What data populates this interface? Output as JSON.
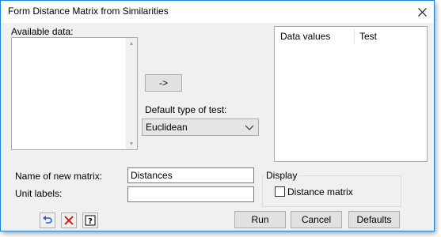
{
  "window": {
    "title": "Form Distance Matrix from Similarities"
  },
  "available_data": {
    "label": "Available data:"
  },
  "transfer_button": {
    "label": "->"
  },
  "default_test": {
    "label": "Default type of test:",
    "selected": "Euclidean"
  },
  "data_table": {
    "columns": [
      "Data values",
      "Test"
    ]
  },
  "new_matrix": {
    "label": "Name of new matrix:",
    "value": "Distances"
  },
  "unit_labels": {
    "label": "Unit labels:",
    "value": ""
  },
  "display": {
    "group_label": "Display",
    "distance_matrix_label": "Distance matrix",
    "distance_matrix_checked": false
  },
  "buttons": {
    "run": "Run",
    "cancel": "Cancel",
    "defaults": "Defaults"
  },
  "icons": {
    "restore": "undo-icon",
    "clear": "clear-x-icon",
    "help": "help-icon"
  },
  "colors": {
    "accent": "#1883d7",
    "clear_red": "#c42b1c",
    "restore_blue": "#2a5bd7"
  }
}
